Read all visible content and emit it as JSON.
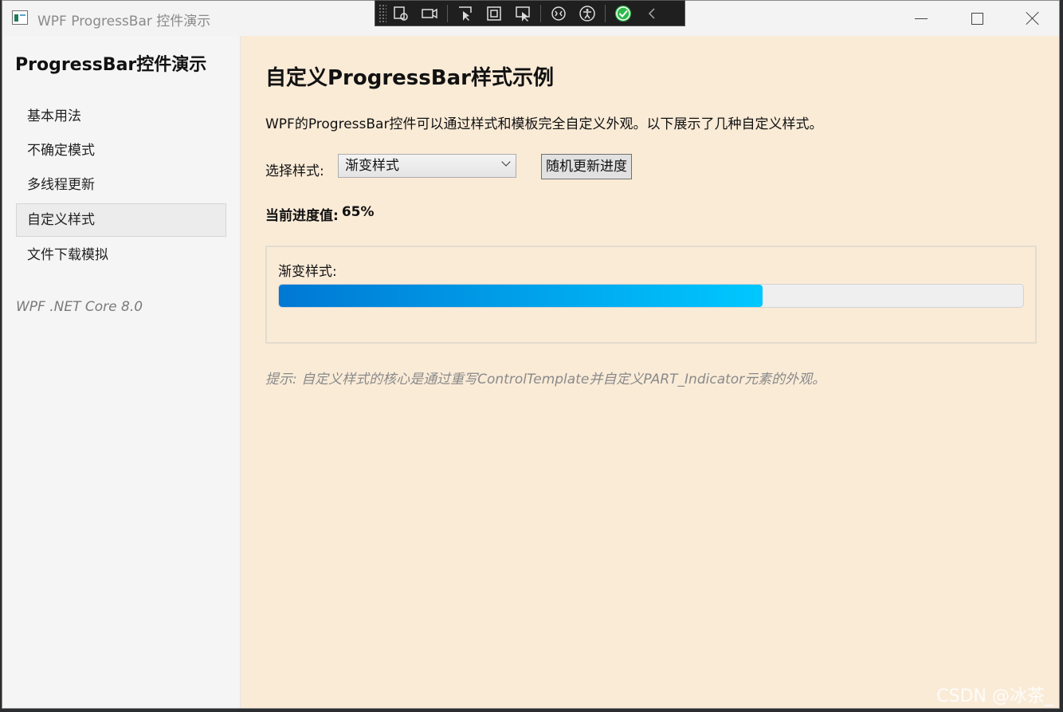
{
  "window": {
    "title": "WPF ProgressBar 控件演示",
    "caption_icons": [
      "minimize-icon",
      "maximize-icon",
      "close-icon"
    ]
  },
  "debug_toolbar": {
    "icons": [
      "select-element-icon",
      "record-icon",
      "select-pointer-icon",
      "layout-adorner-icon",
      "track-focus-icon",
      "hot-reload-icon",
      "accessibility-icon",
      "check-circle-icon",
      "collapse-icon"
    ]
  },
  "sidebar": {
    "title": "ProgressBar控件演示",
    "items": [
      {
        "label": "基本用法",
        "active": false
      },
      {
        "label": "不确定模式",
        "active": false
      },
      {
        "label": "多线程更新",
        "active": false
      },
      {
        "label": "自定义样式",
        "active": true
      },
      {
        "label": "文件下载模拟",
        "active": false
      }
    ],
    "version": "WPF .NET Core 8.0"
  },
  "main": {
    "title": "自定义ProgressBar样式示例",
    "description": "WPF的ProgressBar控件可以通过样式和模板完全自定义外观。以下展示了几种自定义样式。",
    "style_label": "选择样式:",
    "style_selected": "渐变样式",
    "random_button": "随机更新进度",
    "current_label": "当前进度值:",
    "current_value": "65%",
    "panel_label": "渐变样式:",
    "progress": 65,
    "progress_colors": {
      "start": "#0078d4",
      "end": "#00c8ff"
    },
    "hint": "提示: 自定义样式的核心是通过重写ControlTemplate并自定义PART_Indicator元素的外观。"
  },
  "watermark": "CSDN @冰茶_"
}
